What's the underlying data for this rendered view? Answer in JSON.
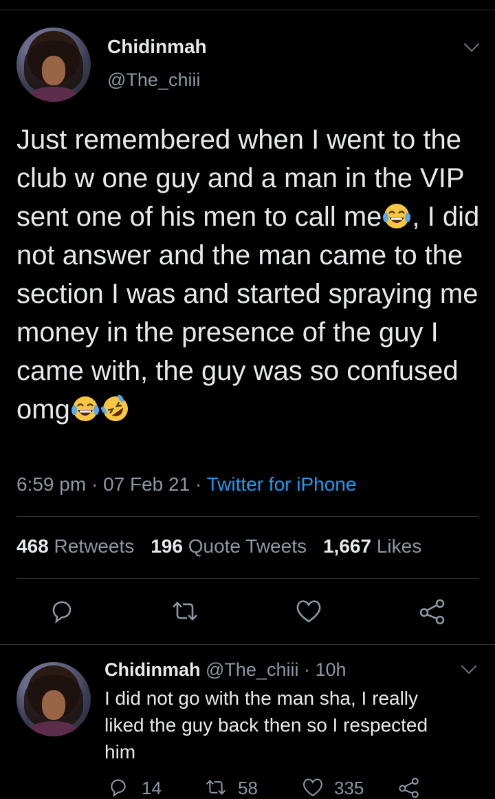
{
  "tweet": {
    "author_name": "Chidinmah",
    "author_handle": "@The_chiii",
    "text_part1": "Just remembered when I went to the club w one guy and a man in the VIP sent one of his men to call me",
    "text_part2": ", I did not answer and the man came to the section I was and started spraying me money in the presence of the guy I came with, the guy was so confused omg",
    "emojis": [
      "face-with-tears-of-joy",
      "face-with-tears-of-joy",
      "rolling-on-floor-laughing"
    ],
    "time": "6:59 pm",
    "date": "07 Feb 21",
    "source": "Twitter for iPhone",
    "separator": " · "
  },
  "stats": {
    "retweets_count": "468",
    "retweets_label": "Retweets",
    "quotes_count": "196",
    "quotes_label": "Quote Tweets",
    "likes_count": "1,667",
    "likes_label": "Likes"
  },
  "actions": [
    "reply-icon",
    "retweet-icon",
    "like-icon",
    "share-icon"
  ],
  "reply": {
    "author_name": "Chidinmah",
    "author_handle": "@The_chiii",
    "time_ago": "10h",
    "separator": " · ",
    "text": "I did not go with the man sha, I really liked the guy back then so I respected him",
    "reply_count": "14",
    "retweet_count": "58",
    "like_count": "335"
  },
  "colors": {
    "background": "#000000",
    "text": "#e7e9ea",
    "muted": "#8b98a5",
    "link": "#1d9bf0",
    "divider": "#2f3336"
  }
}
